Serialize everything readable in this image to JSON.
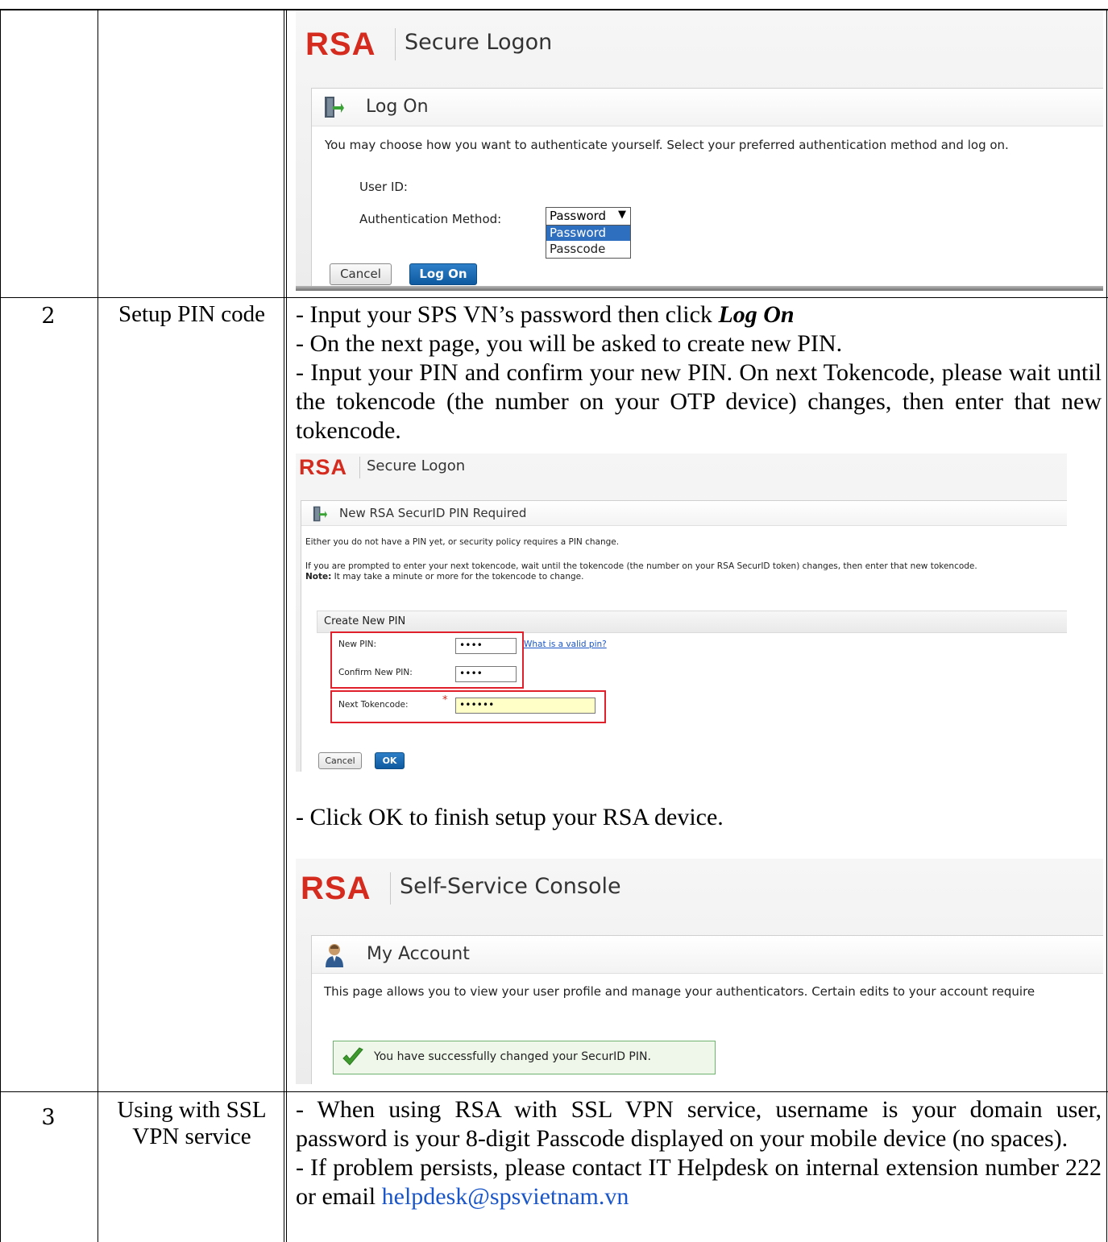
{
  "rows": [
    {
      "number": "2",
      "step": "Setup PIN code",
      "paragraphs": [
        {
          "prefix": "- Input your SPS VN’s password then click ",
          "emph": "Log On"
        },
        {
          "text": "- On the next page, you will be asked to create new PIN."
        },
        {
          "text": "- Input your PIN and confirm your new PIN. On next Tokencode, please wait until the tokencode (the number on your OTP device) changes, then enter that new tokencode."
        }
      ],
      "after_screenshot_text": "- Click OK to finish setup your RSA device."
    },
    {
      "number": "3",
      "step": "Using with SSL VPN service",
      "paragraphs": [
        {
          "text": "- When using RSA with SSL VPN service, username is your domain user, password is your 8-digit Passcode displayed on your mobile device (no spaces)."
        },
        {
          "prefix": "- If problem persists, please contact IT Helpdesk on internal extension number 222 or email ",
          "link": "helpdesk@spsvietnam.vn"
        }
      ]
    }
  ],
  "screenshot_logon": {
    "logo": "RSA",
    "app_title": "Secure Logon",
    "panel_title": "Log On",
    "instruction": "You may choose how you want to authenticate yourself. Select your preferred authentication method and log on.",
    "user_id_label": "User ID:",
    "auth_method_label": "Authentication Method:",
    "auth_selected": "Password",
    "auth_options": [
      "Password",
      "Passcode"
    ],
    "cancel_label": "Cancel",
    "logon_label": "Log On"
  },
  "screenshot_pin": {
    "logo": "RSA",
    "app_title": "Secure Logon",
    "panel_title": "New RSA SecurID PIN Required",
    "line1": "Either you do not have a PIN yet, or security policy requires a PIN change.",
    "line2": "If you are prompted to enter your next tokencode, wait until the tokencode (the number on your RSA SecurID token) changes, then enter that new tokencode.",
    "note_label": "Note:",
    "note_text": " It may take a minute or more for the tokencode to change.",
    "section_title": "Create New PIN",
    "new_pin_label": "New PIN:",
    "new_pin_value": "••••",
    "valid_pin_link": "What is a valid pin?",
    "confirm_pin_label": "Confirm New PIN:",
    "confirm_pin_value": "••••",
    "next_token_label": "Next Tokencode:",
    "required_mark": "*",
    "next_token_value": "••••••",
    "cancel_label": "Cancel",
    "ok_label": "OK"
  },
  "screenshot_console": {
    "logo": "RSA",
    "app_title": "Self-Service Console",
    "panel_title": "My Account",
    "description": "This page allows you to view your user profile and manage your authenticators. Certain edits to your account require",
    "success_message": "You have successfully changed your SecurID PIN."
  },
  "colors": {
    "rsa_red": "#d52b1e",
    "button_blue": "#0f5aa0",
    "highlight_red": "#e0202a",
    "link_blue": "#1a56c8",
    "success_green": "#6fb26f"
  }
}
